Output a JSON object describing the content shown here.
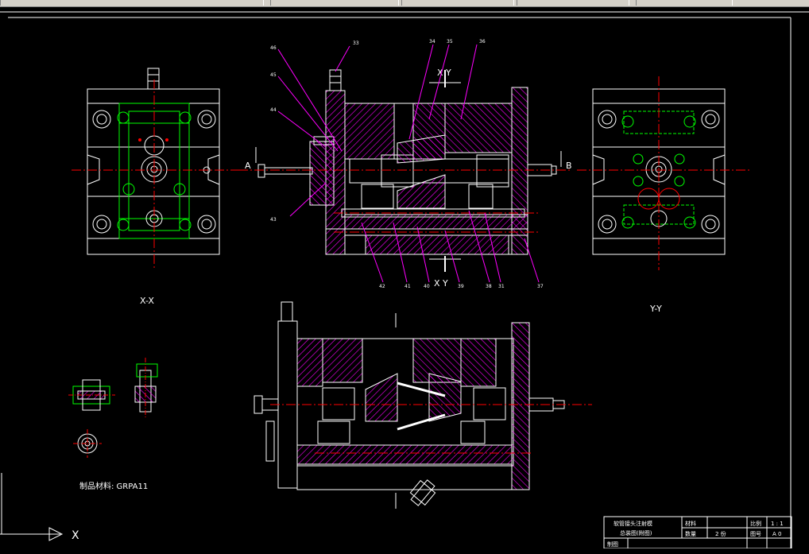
{
  "window": {
    "tabs": [
      "",
      "",
      "",
      "",
      ""
    ],
    "colors": {
      "background": "#000000",
      "outline": "#ffffff",
      "hatch": "#ff00ff",
      "hidden": "#00ff00",
      "centerline": "#ff0000",
      "leader": "#ff00ff"
    }
  },
  "views": {
    "xx_label": "X-X",
    "yy_label": "Y-Y",
    "section_top": "X Y",
    "section_bottom": "X Y",
    "arrow_a": "A",
    "arrow_b": "B",
    "ucs_axis": "X"
  },
  "balloons": {
    "top": [
      "46",
      "45",
      "44",
      "33",
      "34",
      "35",
      "36",
      "43"
    ],
    "bottom": [
      "42",
      "41",
      "40",
      "39",
      "38",
      "31",
      "37"
    ]
  },
  "material_note": "制品材料: GRPA11",
  "title_block": {
    "title_line1": "软管接头注射模",
    "title_line2": "总装图(附图)",
    "material_label": "材料",
    "scale_label": "比例",
    "scale_value": "1 : 1",
    "qty_label": "数量",
    "qty_value": "2 份",
    "drawing_no_label": "图号",
    "drawing_no_value": "A 0",
    "drawn_label": "制图"
  }
}
